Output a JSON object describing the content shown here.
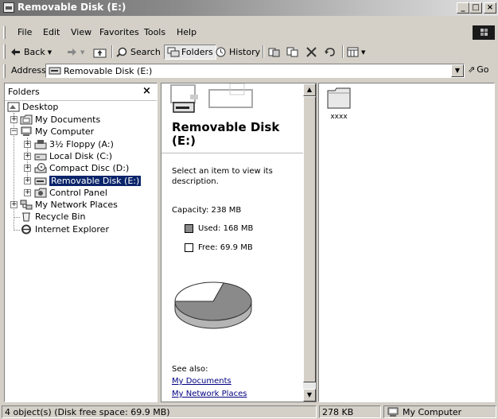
{
  "window": {
    "title": "Removable Disk (E:)",
    "minimize_label": "_",
    "maximize_label": "□",
    "close_label": "×"
  },
  "menu": [
    "File",
    "Edit",
    "View",
    "Favorites",
    "Tools",
    "Help"
  ],
  "toolbar": {
    "back_label": "Back",
    "search_label": "Search",
    "folders_label": "Folders",
    "history_label": "History"
  },
  "address": {
    "label": "Address",
    "value": "Removable Disk (E:)",
    "go_label": "Go"
  },
  "folders_pane": {
    "title": "Folders",
    "close_label": "×",
    "tree": [
      {
        "label": "Desktop",
        "icon": "desktop-icon"
      },
      {
        "label": "My Documents",
        "icon": "documents-folder-icon"
      },
      {
        "label": "My Computer",
        "icon": "computer-icon"
      },
      {
        "label": "3½ Floppy (A:)",
        "icon": "floppy-drive-icon"
      },
      {
        "label": "Local Disk (C:)",
        "icon": "hard-drive-icon"
      },
      {
        "label": "Compact Disc (D:)",
        "icon": "cd-drive-icon"
      },
      {
        "label": "Removable Disk (E:)",
        "icon": "removable-drive-icon"
      },
      {
        "label": "Control Panel",
        "icon": "control-panel-icon"
      },
      {
        "label": "My Network Places",
        "icon": "network-places-icon"
      },
      {
        "label": "Recycle Bin",
        "icon": "recycle-bin-icon"
      },
      {
        "label": "Internet Explorer",
        "icon": "internet-explorer-icon"
      }
    ]
  },
  "info_pane": {
    "heading": "Removable Disk (E:)",
    "description": "Select an item to view its description.",
    "capacity": "Capacity: 238 MB",
    "used": "Used: 168 MB",
    "free": "Free: 69.9 MB",
    "used_fraction": 0.706,
    "see_also": "See also:",
    "links": [
      "My Documents",
      "My Network Places"
    ]
  },
  "content": {
    "items": [
      {
        "name": "xxxx",
        "icon": "folder-icon"
      }
    ]
  },
  "status": {
    "objects": "4 object(s) (Disk free space: 69.9 MB)",
    "size": "278 KB",
    "zone": "My Computer"
  },
  "colors": {
    "selection": "#0a246a",
    "pie_used": "#8a8a8a",
    "pie_free": "#ffffff",
    "link": "#000080"
  }
}
